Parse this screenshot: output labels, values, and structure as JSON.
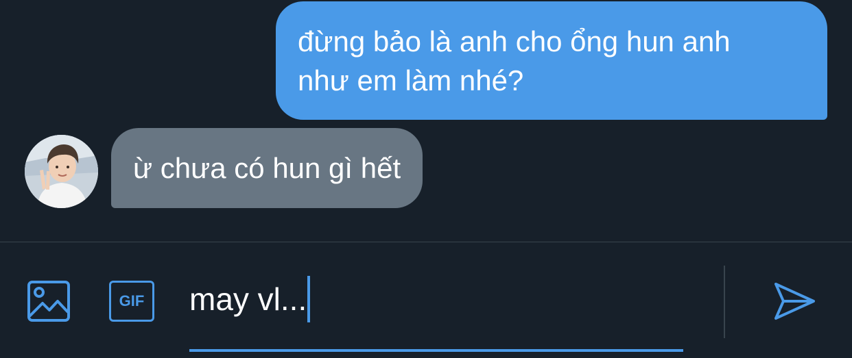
{
  "thread": {
    "sent_message": {
      "line1": "đừng bảo là anh cho ổng hun anh",
      "line2": "như em làm nhé?"
    },
    "received_message": {
      "text": "ừ chưa có hun gì hết",
      "avatar_icon": "user-avatar-photo"
    }
  },
  "composer": {
    "media_icon": "image-icon",
    "gif_label": "GIF",
    "input_value": "may vl...",
    "send_icon": "send-icon"
  },
  "colors": {
    "background": "#17202a",
    "accent": "#4a9ae8",
    "sent_bubble": "#4a9ae8",
    "received_bubble": "#687683",
    "divider": "#38444d"
  }
}
